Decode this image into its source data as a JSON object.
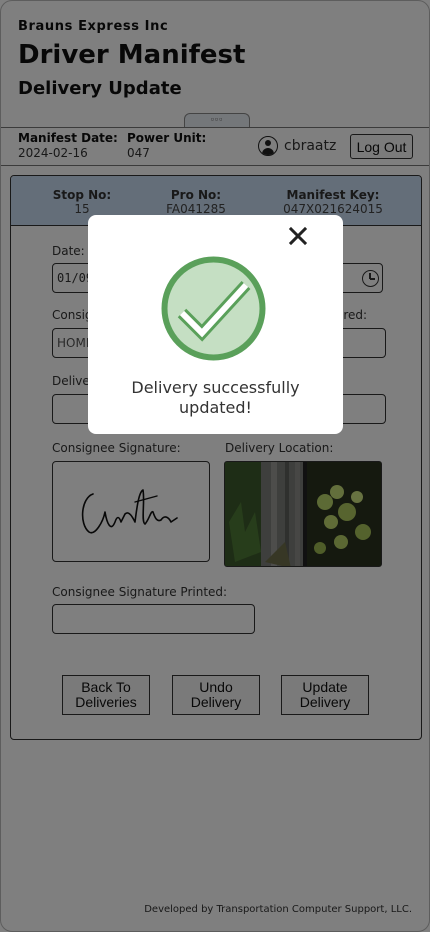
{
  "app": {
    "company": "Brauns Express Inc",
    "title": "Driver Manifest",
    "page": "Delivery Update"
  },
  "drag_handle_text": "▫▫▫",
  "info_bar": {
    "manifest_date_label": "Manifest Date:",
    "manifest_date": "2024-02-16",
    "power_unit_label": "Power Unit:",
    "power_unit": "047",
    "username": "cbraatz",
    "logout_label": "Log Out"
  },
  "stop": {
    "stop_no_label": "Stop No:",
    "stop_no": "15",
    "pro_no_label": "Pro No:",
    "pro_no": "FA041285",
    "manifest_key_label": "Manifest Key:",
    "manifest_key": "047X021624015"
  },
  "form": {
    "date_label": "Date:",
    "date_value": "01/09",
    "consignee_label": "Consigne",
    "consignee_value": "HOME",
    "delivered_label": "ered:",
    "delivery_label": "Delive",
    "consignee_signature_label": "Consignee Signature:",
    "delivery_location_label": "Delivery Location:",
    "signature_printed_label": "Consignee Signature Printed:",
    "signature_printed_value": ""
  },
  "buttons": {
    "back": "Back To Deliveries",
    "undo": "Undo Delivery",
    "update": "Update Delivery"
  },
  "footer": "Developed by Transportation Computer Support, LLC.",
  "modal": {
    "message": "Delivery successfully updated!",
    "close_icon": "close-icon",
    "success_icon": "check-circle-icon"
  },
  "colors": {
    "card_header": "#c8dcf2",
    "success_green": "#5aa05a",
    "success_fill": "#c5dfc3",
    "overlay": "rgba(0,0,0,0.5)"
  }
}
